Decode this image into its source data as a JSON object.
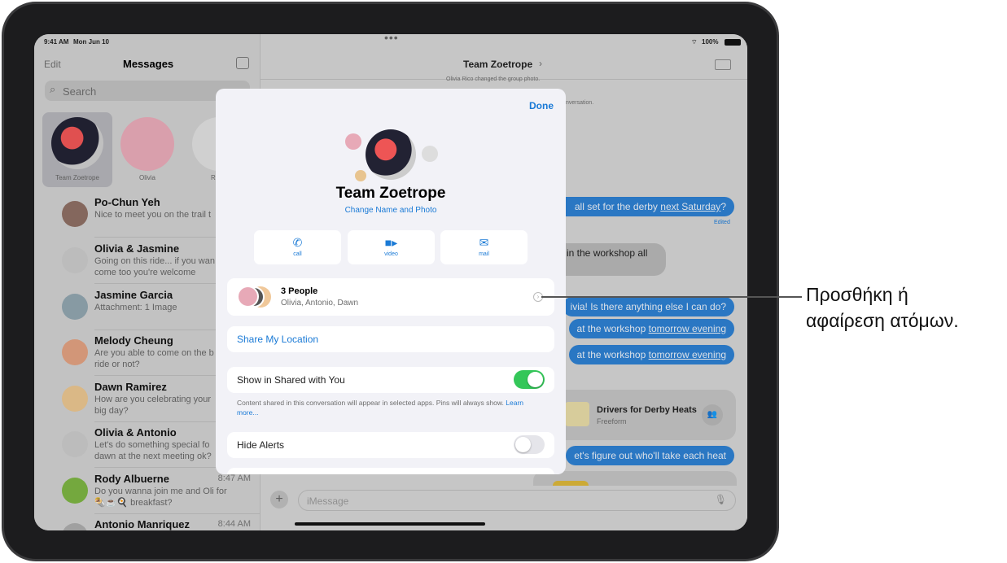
{
  "status_bar": {
    "time": "9:41 AM",
    "date": "Mon Jun 10",
    "battery": "100%"
  },
  "sidebar": {
    "edit": "Edit",
    "title": "Messages",
    "search_placeholder": "Search",
    "pinned": [
      {
        "name": "Team Zoetrope"
      },
      {
        "name": "Olivia"
      },
      {
        "name": "R"
      }
    ],
    "conversations": [
      {
        "name": "Po-Chun Yeh",
        "preview": "Nice to meet you on the trail t",
        "time": ""
      },
      {
        "name": "Olivia & Jasmine",
        "preview": "Going on this ride... if you wan",
        "preview2": "come too you're welcome",
        "time": ""
      },
      {
        "name": "Jasmine Garcia",
        "preview": "Attachment: 1 Image",
        "time": ""
      },
      {
        "name": "Melody Cheung",
        "preview": "Are you able to come on the b",
        "preview2": "ride or not?",
        "time": ""
      },
      {
        "name": "Dawn Ramirez",
        "preview": "How are you celebrating your",
        "preview2": "big day?",
        "time": ""
      },
      {
        "name": "Olivia & Antonio",
        "preview": "Let's do something special fo",
        "preview2": "dawn at the next meeting ok?",
        "time": ""
      },
      {
        "name": "Rody Albuerne",
        "preview": "Do you wanna join me and Oli for",
        "preview2": "🌯☕🍳 breakfast?",
        "time": "8:47 AM"
      },
      {
        "name": "Antonio Manriquez",
        "preview": "",
        "time": "8:44 AM"
      }
    ]
  },
  "chat": {
    "title": "Team Zoetrope",
    "system1": "Olivia Rico changed the group photo.",
    "system2": "nversation.",
    "messages": [
      {
        "pre": "all set for the derby ",
        "link": "next Saturday",
        "post": "?"
      },
      {
        "text": "in the workshop all"
      },
      {
        "text": "ivia! Is there anything else I can do?"
      },
      {
        "pre": "at the workshop ",
        "link": "tomorrow evening",
        "post": ""
      },
      {
        "pre": "at the workshop ",
        "link": "tomorrow evening",
        "post": ""
      },
      {
        "text": "et's figure out who'll take each heat"
      }
    ],
    "edited": "Edited",
    "freeform": {
      "title": "Drivers for Derby Heats",
      "subtitle": "Freeform"
    },
    "input_placeholder": "iMessage"
  },
  "modal": {
    "done": "Done",
    "group_name": "Team Zoetrope",
    "change": "Change Name and Photo",
    "actions": [
      {
        "label": "call",
        "icon": "phone-icon"
      },
      {
        "label": "video",
        "icon": "video-icon"
      },
      {
        "label": "mail",
        "icon": "mail-icon"
      }
    ],
    "people_title": "3 People",
    "people_names": "Olivia, Antonio, Dawn",
    "share_location": "Share My Location",
    "shared_with_you": {
      "label": "Show in Shared with You",
      "on": true
    },
    "shared_note": "Content shared in this conversation will appear in selected apps. Pins will always show.",
    "learn_more": "Learn more...",
    "hide_alerts": {
      "label": "Hide Alerts",
      "on": false
    }
  },
  "callout": {
    "line1": "Προσθήκη ή",
    "line2": "αφαίρεση ατόμων."
  },
  "colors": {
    "accent": "#1a7ad6",
    "toggle_on": "#34c759",
    "bubble": "#2d7fd0"
  }
}
